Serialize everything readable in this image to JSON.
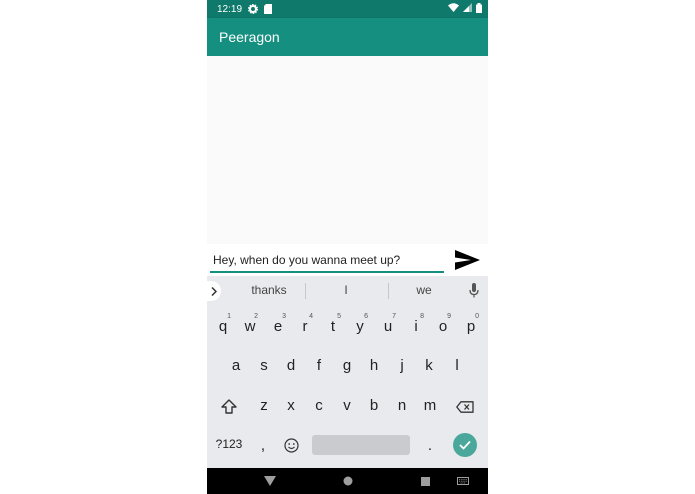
{
  "status_bar": {
    "time": "12:19"
  },
  "app_bar": {
    "title": "Peeragon"
  },
  "composer": {
    "message_value": "Hey, when do you wanna meet up?"
  },
  "keyboard": {
    "suggestions": [
      "thanks",
      "I",
      "we"
    ],
    "row1": [
      {
        "key": "q",
        "hint": "1"
      },
      {
        "key": "w",
        "hint": "2"
      },
      {
        "key": "e",
        "hint": "3"
      },
      {
        "key": "r",
        "hint": "4"
      },
      {
        "key": "t",
        "hint": "5"
      },
      {
        "key": "y",
        "hint": "6"
      },
      {
        "key": "u",
        "hint": "7"
      },
      {
        "key": "i",
        "hint": "8"
      },
      {
        "key": "o",
        "hint": "9"
      },
      {
        "key": "p",
        "hint": "0"
      }
    ],
    "row2": [
      "a",
      "s",
      "d",
      "f",
      "g",
      "h",
      "j",
      "k",
      "l"
    ],
    "row3": [
      "z",
      "x",
      "c",
      "v",
      "b",
      "n",
      "m"
    ],
    "symbols_label": "?123",
    "comma_label": ",",
    "period_label": "."
  },
  "colors": {
    "primary": "#148f80",
    "primary_dark": "#0f7a6c",
    "accent": "#49a89b"
  }
}
